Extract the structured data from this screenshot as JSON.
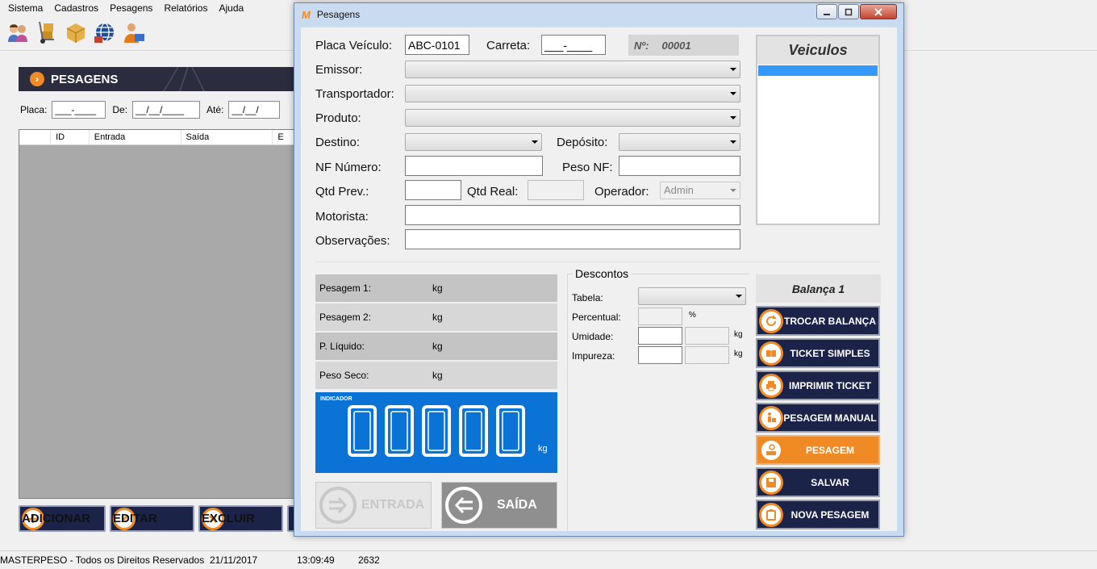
{
  "menu": [
    "Sistema",
    "Cadastros",
    "Pesagens",
    "Relatórios",
    "Ajuda"
  ],
  "toolbar_icons": [
    "users-icon",
    "hand-truck-icon",
    "package-icon",
    "globe-icon",
    "user-card-icon"
  ],
  "section": {
    "title": "PESAGENS"
  },
  "filters": {
    "placa_label": "Placa:",
    "placa_value": "___-____",
    "de_label": "De:",
    "de_value": "__/__/____",
    "ate_label": "Até:",
    "ate_value": "__/__/"
  },
  "grid": {
    "columns": [
      "ID",
      "Entrada",
      "Saída",
      "E"
    ]
  },
  "actions": {
    "adicionar": "ADICIONAR",
    "editar": "EDITAR",
    "excluir": "EXCLUIR"
  },
  "status": {
    "company": "MASTERPESO - Todos os Direitos Reservados",
    "date": "21/11/2017",
    "time": "13:09:49",
    "code": "2632"
  },
  "dialog": {
    "logo": "M",
    "title": "Pesagens",
    "placa_label": "Placa Veículo:",
    "placa_value": "ABC-0101",
    "carreta_label": "Carreta:",
    "carreta_value": "___-____",
    "num_label": "Nº:",
    "num_value": "00001",
    "emissor_label": "Emissor:",
    "transportador_label": "Transportador:",
    "produto_label": "Produto:",
    "destino_label": "Destino:",
    "deposito_label": "Depósito:",
    "nf_numero_label": "NF Número:",
    "peso_nf_label": "Peso NF:",
    "qtd_prev_label": "Qtd Prev.:",
    "qtd_real_label": "Qtd Real:",
    "operador_label": "Operador:",
    "operador_value": "Admin",
    "motorista_label": "Motorista:",
    "observacoes_label": "Observações:",
    "veiculos_title": "Veiculos",
    "pesagem1_label": "Pesagem 1:",
    "pesagem2_label": "Pesagem 2:",
    "liquido_label": "P. Líquido:",
    "peso_seco_label": "Peso Seco:",
    "unit_kg": "kg",
    "indicator_label": "INDICADOR",
    "indicator_value": "00000",
    "indicator_unit": "kg",
    "entrada_label": "ENTRADA",
    "saida_label": "SAÍDA",
    "descontos_title": "Descontos",
    "tabela_label": "Tabela:",
    "percentual_label": "Percentual:",
    "percent_unit": "%",
    "umidade_label": "Umidade:",
    "impureza_label": "Impureza:",
    "balanca_title": "Balança 1",
    "btn_trocar": "TROCAR BALANÇA",
    "btn_ticket_simples": "TICKET SIMPLES",
    "btn_imprimir": "IMPRIMIR TICKET",
    "btn_manual": "PESAGEM MANUAL",
    "btn_pesagem": "PESAGEM",
    "btn_salvar": "SALVAR",
    "btn_nova": "NOVA PESAGEM"
  },
  "colors": {
    "accent": "#f08a24",
    "navy": "#1c2348",
    "indicator": "#0b73d6"
  }
}
